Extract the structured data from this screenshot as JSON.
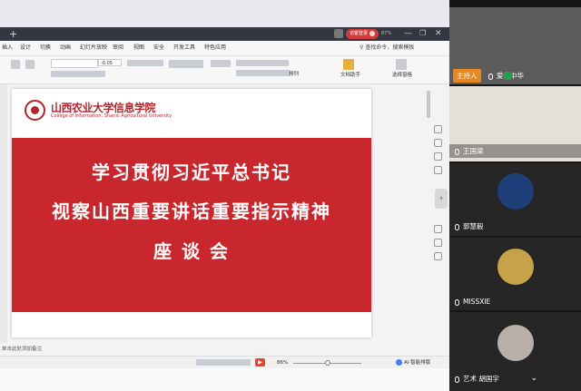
{
  "window": {
    "login_label": "访客登录",
    "vip_label": "87%",
    "min": "—",
    "max": "❐",
    "close": "✕",
    "plus": "+"
  },
  "menus": [
    "插入",
    "设计",
    "切换",
    "动画",
    "幻灯片放映",
    "审阅",
    "视图",
    "安全",
    "开发工具",
    "特色应用"
  ],
  "search_label": "查找命令、搜索模板",
  "ribbon": {
    "fontsize": "-0.05",
    "arrange": "排列",
    "doc_helper": "文档助手",
    "select_pane": "选择窗格"
  },
  "slide": {
    "logo_cn": "山西农业大学信息学院",
    "logo_en": "College of Information, Shanxi Agricultural University",
    "title_line1": "学习贯彻习近平总书记",
    "title_line2": "视察山西重要讲话重要指示精神",
    "title_line3": "座 谈 会"
  },
  "notes_placeholder": "单击此处添加备注",
  "status": {
    "zoom": "86%",
    "ai": "AI·智能排版"
  },
  "participants": [
    {
      "name": "爱我中华",
      "host_badge": "主持人"
    },
    {
      "name": "王国梁"
    },
    {
      "name": "郭慧毅"
    },
    {
      "name": "MISSXIE"
    },
    {
      "name": "艺术 胡国宇"
    }
  ],
  "colors": {
    "accent_red": "#c8272e",
    "host_orange": "#e8871f"
  }
}
